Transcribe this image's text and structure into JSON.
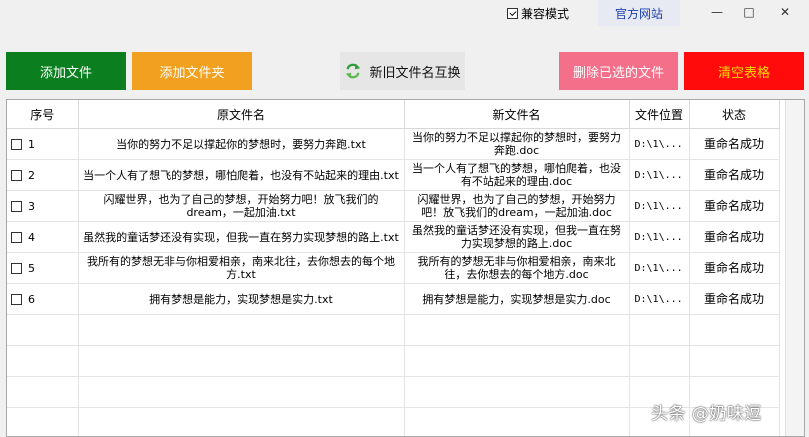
{
  "titlebar": {
    "compat_label": "兼容模式",
    "compat_checked": true,
    "official_label": "官方网站",
    "min_label": "—",
    "max_label": "□",
    "close_label": "✕"
  },
  "toolbar": {
    "add_file": "添加文件",
    "add_folder": "添加文件夹",
    "swap_names": "新旧文件名互换",
    "delete_selected": "删除已选的文件",
    "clear_table": "清空表格"
  },
  "table": {
    "headers": [
      "序号",
      "原文件名",
      "新文件名",
      "文件位置",
      "状态"
    ],
    "rows": [
      {
        "index": "1",
        "old": "当你的努力不足以撑起你的梦想时，要努力奔跑.txt",
        "new": "当你的努力不足以撑起你的梦想时，要努力奔跑.doc",
        "path": "D:\\1\\...",
        "status": "重命名成功"
      },
      {
        "index": "2",
        "old": "当一个人有了想飞的梦想，哪怕爬着，也没有不站起来的理由.txt",
        "new": "当一个人有了想飞的梦想，哪怕爬着，也没有不站起来的理由.doc",
        "path": "D:\\1\\...",
        "status": "重命名成功"
      },
      {
        "index": "3",
        "old": "闪耀世界，也为了自己的梦想，开始努力吧！放飞我们的dream，一起加油.txt",
        "new": "闪耀世界，也为了自己的梦想，开始努力吧！放飞我们的dream，一起加油.doc",
        "path": "D:\\1\\...",
        "status": "重命名成功"
      },
      {
        "index": "4",
        "old": "虽然我的童话梦还没有实现，但我一直在努力实现梦想的路上.txt",
        "new": "虽然我的童话梦还没有实现，但我一直在努力实现梦想的路上.doc",
        "path": "D:\\1\\...",
        "status": "重命名成功"
      },
      {
        "index": "5",
        "old": "我所有的梦想无非与你相爱相亲，南来北往，去你想去的每个地方.txt",
        "new": "我所有的梦想无非与你相爱相亲，南来北往，去你想去的每个地方.doc",
        "path": "D:\\1\\...",
        "status": "重命名成功"
      },
      {
        "index": "6",
        "old": "拥有梦想是能力，实现梦想是实力.txt",
        "new": "拥有梦想是能力，实现梦想是实力.doc",
        "path": "D:\\1\\...",
        "status": "重命名成功"
      }
    ],
    "empty_rows": 4
  },
  "watermark": "头条 @奶味逗",
  "colors": {
    "add_file": "#0b7f1f",
    "add_folder": "#f2a01f",
    "delete_selected": "#f36f8a",
    "clear_table": "#ff0b0b",
    "clear_text": "#ffd900",
    "official_link": "#1c3fb0"
  }
}
